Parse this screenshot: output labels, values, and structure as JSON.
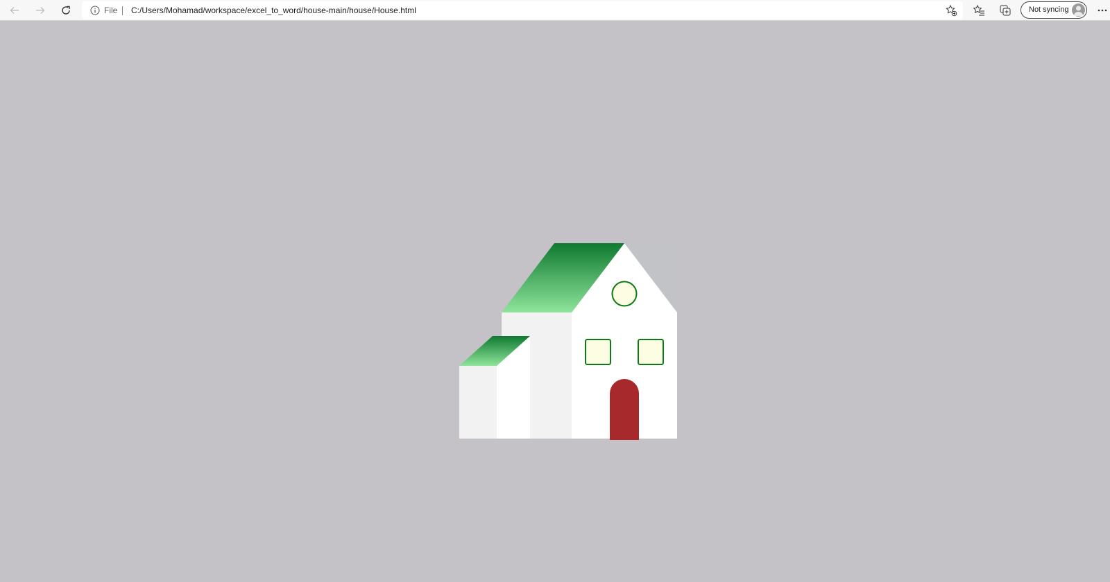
{
  "browser": {
    "address_prefix": "File",
    "url": "C:/Users/Mohamad/workspace/excel_to_word/house-main/house/House.html",
    "sync_status": "Not syncing"
  },
  "icons": {
    "back": "arrow-left-icon",
    "forward": "arrow-right-icon",
    "reload": "reload-icon",
    "info": "info-icon",
    "add_favorite": "star-plus-icon",
    "favorites": "favorites-list-icon",
    "collections": "collections-icon",
    "profile": "avatar-icon",
    "menu": "more-icon"
  },
  "colors": {
    "page_background": "#c4c2c7",
    "roof_dark": "#0f7a30",
    "roof_light": "#8fe49b",
    "wall_white": "#ffffff",
    "wall_shade": "#f2f2f2",
    "gable_shadow": "#c2c3c6",
    "window_fill": "#fdfde3",
    "window_stroke": "#0c7a14",
    "door": "#a8292c"
  }
}
